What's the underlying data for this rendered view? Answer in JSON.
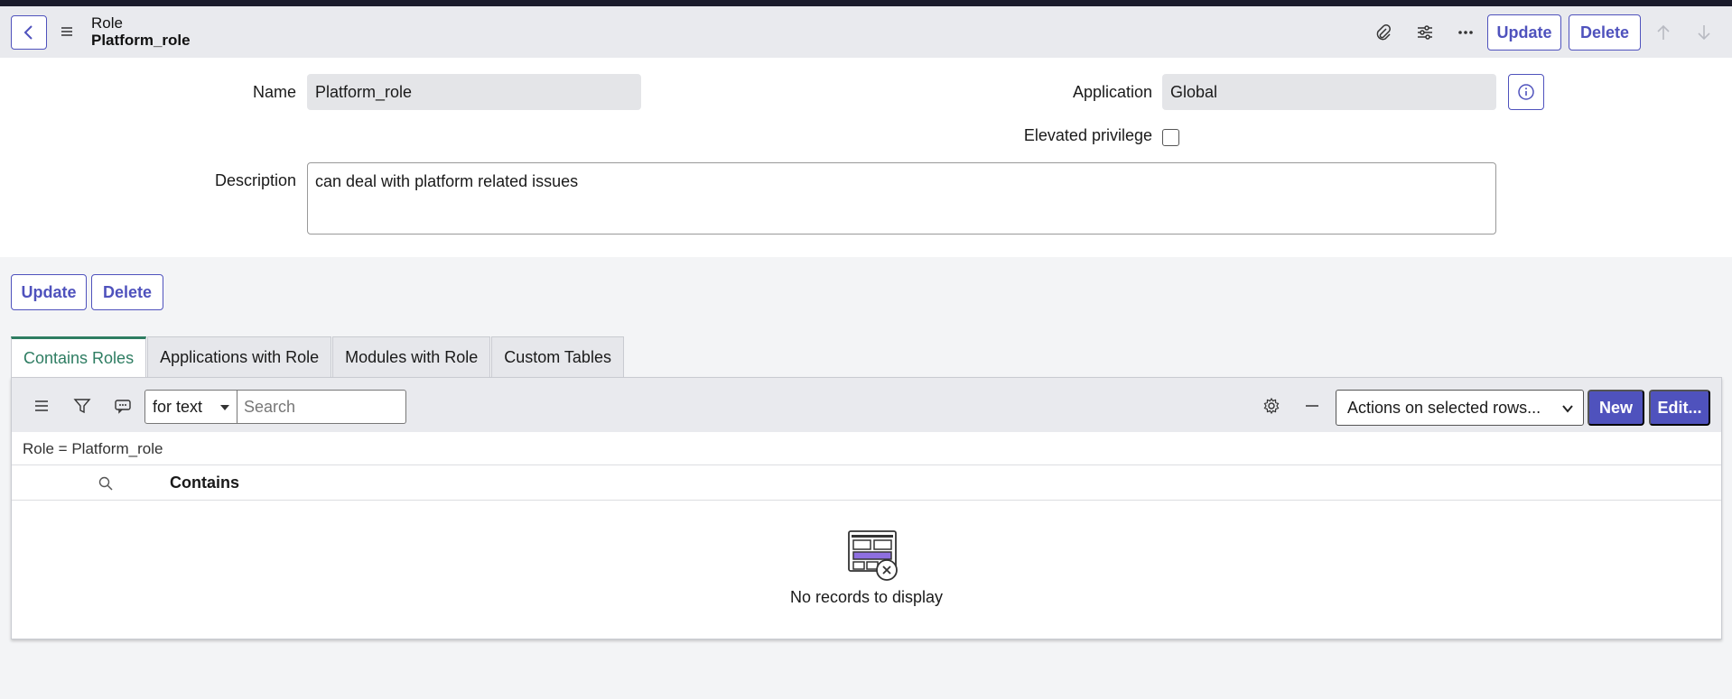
{
  "header": {
    "title_line1": "Role",
    "title_line2": "Platform_role",
    "update_label": "Update",
    "delete_label": "Delete"
  },
  "form": {
    "name_label": "Name",
    "name_value": "Platform_role",
    "application_label": "Application",
    "application_value": "Global",
    "elevated_label": "Elevated privilege",
    "elevated_checked": false,
    "description_label": "Description",
    "description_value": "can deal with platform related issues"
  },
  "form_actions": {
    "update_label": "Update",
    "delete_label": "Delete"
  },
  "tabs": [
    {
      "label": "Contains Roles",
      "active": true
    },
    {
      "label": "Applications with Role",
      "active": false
    },
    {
      "label": "Modules with Role",
      "active": false
    },
    {
      "label": "Custom Tables",
      "active": false
    }
  ],
  "related_list": {
    "search_field_select": "for text",
    "search_placeholder": "Search",
    "actions_select": "Actions on selected rows...",
    "new_label": "New",
    "edit_label": "Edit...",
    "breadcrumb": "Role = Platform_role",
    "column_header": "Contains",
    "empty_message": "No records to display"
  },
  "colors": {
    "accent": "#4f52bd",
    "active_tab": "#2e7d62",
    "header_bg": "#e9eaee"
  }
}
